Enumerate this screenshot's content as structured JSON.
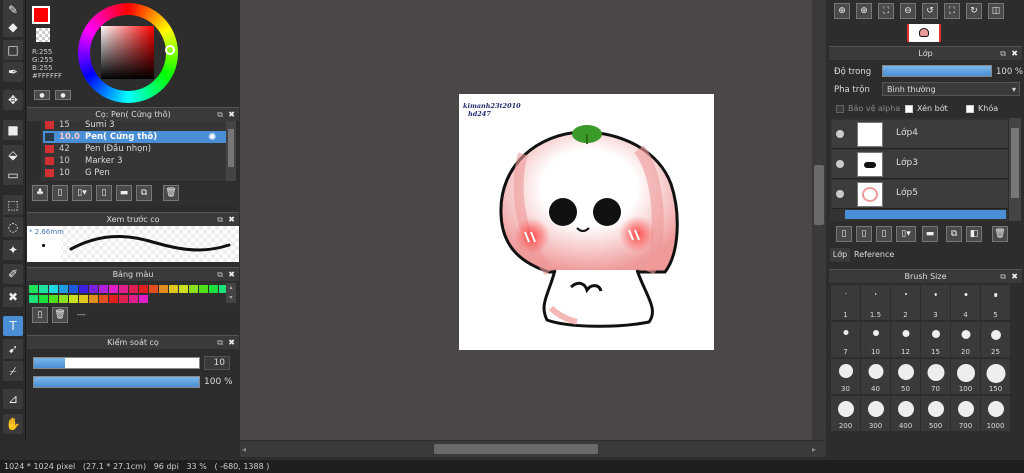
{
  "tools": [
    {
      "name": "brush-tool-icon",
      "glyph": "✎"
    },
    {
      "name": "eraser-tool-icon",
      "glyph": "◆"
    },
    {
      "name": "rectangle-tool-icon",
      "glyph": "□"
    },
    {
      "name": "pen-tool-icon",
      "glyph": "✒"
    },
    {
      "name": "move-tool-icon",
      "glyph": "✥"
    },
    {
      "name": "fill-shape-tool-icon",
      "glyph": "■"
    },
    {
      "name": "bucket-tool-icon",
      "glyph": "⬙"
    },
    {
      "name": "gradient-tool-icon",
      "glyph": "▭"
    },
    {
      "name": "select-rect-tool-icon",
      "glyph": "⬚"
    },
    {
      "name": "lasso-tool-icon",
      "glyph": "◌"
    },
    {
      "name": "magic-wand-tool-icon",
      "glyph": "✦"
    },
    {
      "name": "select-pen-tool-icon",
      "glyph": "✐"
    },
    {
      "name": "select-eraser-tool-icon",
      "glyph": "✖"
    },
    {
      "name": "text-tool-icon",
      "glyph": "T"
    },
    {
      "name": "select-move-tool-icon",
      "glyph": "➹"
    },
    {
      "name": "eyedropper-tool-icon",
      "glyph": "⌿"
    },
    {
      "name": "line-pen-tool-icon",
      "glyph": "⊿"
    },
    {
      "name": "hand-tool-icon",
      "glyph": "✋"
    }
  ],
  "color": {
    "r": "R:255",
    "g": "G:255",
    "b": "B:255",
    "hex": "#FFFFFF",
    "primary": "#ff0000"
  },
  "brush_panel": {
    "title": "Cọ: Pen( Cứng thô)",
    "rows": [
      {
        "size": "15",
        "name": "Sumi 3"
      },
      {
        "size": "10.0",
        "name": "Pen( Cứng thô)"
      },
      {
        "size": "42",
        "name": "Pen (Đầu nhọn)"
      },
      {
        "size": "10",
        "name": "Marker 3"
      },
      {
        "size": "10",
        "name": "G Pen"
      }
    ]
  },
  "preview": {
    "title": "Xem trước cọ",
    "size": "2.66mm"
  },
  "palette": {
    "title": "Bảng màu",
    "dash": "---",
    "colors": [
      "#1ee05a",
      "#1ee0a0",
      "#1ed8e0",
      "#1e9ee0",
      "#1e5ae0",
      "#3c1ee0",
      "#7a1ee0",
      "#b41ee0",
      "#e01ec8",
      "#e01e8c",
      "#e01e50",
      "#e01e1e",
      "#e0501e",
      "#e08c1e",
      "#e0c81e",
      "#c8e01e",
      "#8ce01e",
      "#50e01e",
      "#1ee03c",
      "#1ee078"
    ]
  },
  "brush_control": {
    "title": "Kiểm soát cọ",
    "size_value": "10",
    "opacity_value": "100 %",
    "size_fraction": 0.19,
    "opacity_fraction": 1.0
  },
  "status": {
    "dims": "1024 * 1024 pixel",
    "phys": "(27.1 * 27.1cm)",
    "dpi": "96 dpi",
    "zoom": "33 %",
    "coords": "( -680, 1388 )"
  },
  "artwork": {
    "signature_line1": "kimanh23t2010",
    "signature_line2": "hd247"
  },
  "layer_panel": {
    "title": "Lớp",
    "opacity_label": "Độ trong",
    "opacity_value": "100 %",
    "opacity_fraction": 1.0,
    "blend_label": "Pha trộn",
    "blend_value": "Bình thường",
    "protect_alpha": "Bảo vệ alpha",
    "clipping": "Xén bớt",
    "lock": "Khóa",
    "layers": [
      "Lớp4",
      "Lớp3",
      "Lớp5"
    ]
  },
  "tabs": {
    "layer": "Lớp",
    "reference": "Reference"
  },
  "brush_size": {
    "title": "Brush Size",
    "sizes": [
      "1",
      "1.5",
      "2",
      "3",
      "4",
      "5",
      "7",
      "10",
      "12",
      "15",
      "20",
      "25",
      "30",
      "40",
      "50",
      "70",
      "100",
      "150",
      "200",
      "300",
      "400",
      "500",
      "700",
      "1000"
    ]
  }
}
